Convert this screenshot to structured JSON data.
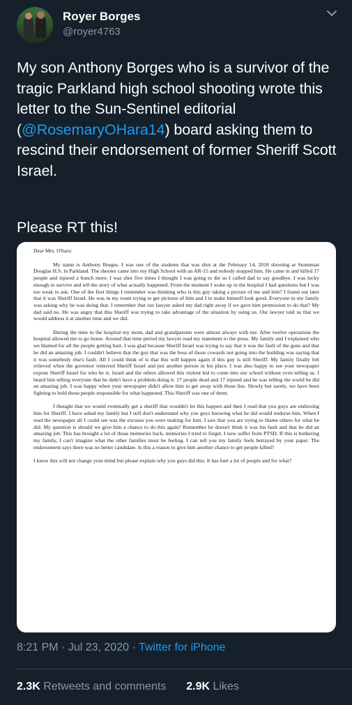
{
  "author": {
    "name": "Royer Borges",
    "handle": "@royer4763"
  },
  "tweet": {
    "text_before": "My son Anthony Borges who is a survivor of the tragic Parkland high school shooting wrote this letter to the Sun-Sentinel editorial (",
    "mention": "@RosemaryOHara14",
    "text_after": ") board asking them to rescind their endorsement of former Sheriff Scott Israel.",
    "cta": "Please RT this!"
  },
  "letter": {
    "greeting": "Dear Mrs. O'hara:",
    "p1": "My name is Anthony Borges. I was one of the students that was shot at the February 14, 2018 shooting at Stoneman Douglas H.S. in Parkland. The shooter came into my High School with an AR-15 and nobody stopped him. He came in and killed 17 people and injured a bunch more. I was shot five times I thought I was going to die so I called dad to say goodbye. I was lucky enough to survive and tell the story of what actually happened. From the moment I woke up in the hospital I had questions but I was too weak to ask. One of the first things I remember was thinking who is this guy taking a picture of me and him? I found out later that it was Sheriff Israel. He was in my room trying to get pictures of him and I to make himself look good. Everyone in my family was asking why he was doing that. I remember that our lawyer asked my dad right away if we gave him permission to do that? My dad said no. He was angry that this Sheriff was trying to take advantage of the situation by using us. Our lawyer told us that we would address it at another time and we did.",
    "p2": "During the time in the hospital my mom, dad and grandparents were almost always with me. After twelve operations the hospital allowed me to go home. Around that time period my lawyer read my statement to the press. My family and I explained who we blamed for all the people getting hurt. I was glad because Sheriff Israel was trying to say that it was the fault of the guns and that he did an amazing job. I couldn't believe that the guy that was the boss of those cowards not going into the building was saying that it was somebody else's fault. All I could think of is that this will happen again if this guy is still Sheriff. My family finally felt relieved when the governor removed Sheriff Israel and put another person in his place. I was also happy to see your newspaper expose Sheriff Israel for who he is. Israel and the others allowed this violent kid to come into our school without even telling us. I heard him telling everyone that he didn't have a problem doing it. 17 people dead and 17 injured and he was telling the world he did an amazing job. I was happy when your newspaper didn't allow him to get away with those lies. Slowly but surely, we have been fighting to hold those people responsible for what happened. This Sheriff was one of them.",
    "p3": "I thought that we would eventually get a sheriff that wouldn't let this happen and then I read that you guys are endorsing him for Sheriff. I have asked my family but I still don't understand why you guys knowing what he did would endorse him. When I read the newspaper all I could see was the excuses you were making for him. I saw that you are trying to blame others for what he did. My question is should we give him a chance to do this again? Remember he doesn't think it was his fault and that he did an amazing job. This has brought a lot of those memories back, memories I tried to forget. I now suffer from PTSD. If this is bothering my family, I can't imagine what the other families must be feeling. I can tell you my family feels betrayed by your paper. The endorsement says there was no better candidate. Is this a reason to give him another chance to get people killed?",
    "p4": "I know this will not change your mind but please explain why you guys did this. It has hurt a lot of people and for what?"
  },
  "meta": {
    "time": "8:21 PM",
    "sep1": " · ",
    "date": "Jul 23, 2020",
    "sep2": " · ",
    "source": "Twitter for iPhone"
  },
  "stats": {
    "retweets_count": "2.3K",
    "retweets_label": " Retweets and comments",
    "likes_count": "2.9K",
    "likes_label": " Likes"
  },
  "colors": {
    "background": "#15202b",
    "text": "#ffffff",
    "secondary": "#8899a6",
    "link": "#1d9bf0",
    "divider": "#38444d"
  },
  "icons": {
    "more": "chevron-down-icon"
  }
}
